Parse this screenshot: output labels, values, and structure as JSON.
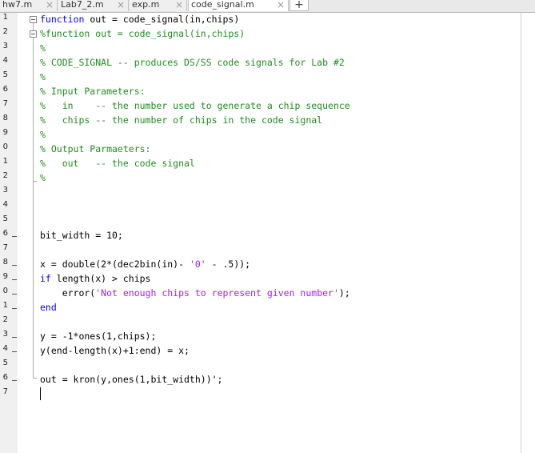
{
  "tabs": [
    {
      "label": "hw7.m"
    },
    {
      "label": "Lab7_2.m"
    },
    {
      "label": "exp.m"
    },
    {
      "label": "code_signal.m"
    }
  ],
  "add_tab_label": "+",
  "close_glyph": "×",
  "line_numbers": [
    "1",
    "2",
    "3",
    "4",
    "5",
    "6",
    "7",
    "8",
    "9",
    "0",
    "1",
    "2",
    "3",
    "4",
    "5",
    "6",
    "7",
    "8",
    "9",
    "0",
    "1",
    "2",
    "3",
    "4",
    "5",
    "6",
    "7"
  ],
  "code": {
    "l1_kw": "function",
    "l1_rest": " out = code_signal(in,chips)",
    "l2": "%function out = code_signal(in,chips)",
    "l3": "%",
    "l4": "% CODE_SIGNAL -- produces DS/SS code signals for Lab #2",
    "l5": "%",
    "l6": "% Input Parameters:",
    "l7": "%   in    -- the number used to generate a chip sequence",
    "l8": "%   chips -- the number of chips in the code signal",
    "l9": "%",
    "l10": "% Output Parmaeters:",
    "l11": "%   out   -- the code signal",
    "l12": "%",
    "l16": "bit_width = 10;",
    "l18": "x = double(2*(dec2bin(in)- ",
    "l18_str": "'0'",
    "l18_rest": " - .5));",
    "l19_kw": "if",
    "l19_rest": " length(x) > chips",
    "l20_pre": "    error(",
    "l20_str": "'Not enough chips to represent given number'",
    "l20_post": ");",
    "l21_kw": "end",
    "l23": "y = -1*ones(1,chips);",
    "l24": "y(end-length(x)+1:end) = x;",
    "l26": "out = kron(y,ones(1,bit_width))';"
  }
}
